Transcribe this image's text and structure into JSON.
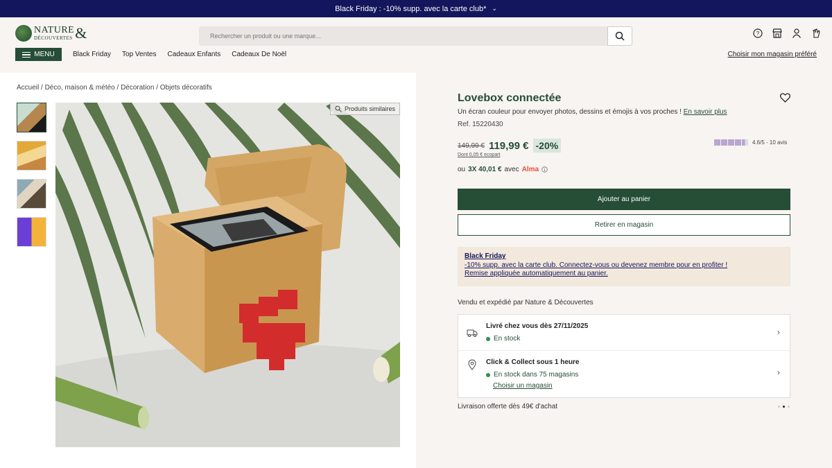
{
  "topbar": {
    "text": "Black Friday : -10% supp. avec la carte club*"
  },
  "header": {
    "logo_top": "NATURE",
    "logo_bottom": "DÉCOUVERTES",
    "logo_amp": "&",
    "search_placeholder": "Rechercher un produit ou une marque...",
    "menu_label": "MENU",
    "nav": [
      "Black Friday",
      "Top Ventes",
      "Cadeaux Enfants",
      "Cadeaux De Noël"
    ],
    "store_link": "Choisir mon magasin préféré"
  },
  "breadcrumb": "Accueil / Déco, maison & météo / Décoration / Objets décoratifs",
  "gallery": {
    "similar_label": "Produits similaires"
  },
  "product": {
    "title": "Lovebox connectée",
    "description": "Un écran couleur pour envoyer photos, dessins et émojis à vos proches !",
    "learn_more": "En savoir plus",
    "ref": "Ref. 15220430",
    "old_price": "149,99 €",
    "new_price": "119,99 €",
    "discount": "-20%",
    "eco_part": "Dont 0,05 € ecopart",
    "rating_value": 4.6,
    "rating_text": "4.6/5 - 10 avis",
    "alma_prefix": "ou",
    "alma_amount": "3X 40,01 €",
    "alma_mid": "avec",
    "alma_brand": "Alma",
    "add_to_cart": "Ajouter au panier",
    "pickup_store": "Retirer en magasin"
  },
  "promo": {
    "title": "Black Friday",
    "line1": "-10% supp. avec la carte club. Connectez-vous ou devenez membre pour en profiter !",
    "line2": "Remise appliquée automatiquement au panier."
  },
  "sold_by": "Vendu et expédié par Nature & Découvertes",
  "delivery": {
    "home_title": "Livré chez vous dès 27/11/2025",
    "home_stock": "En stock",
    "collect_title": "Click & Collect sous 1 heure",
    "collect_stock": "En stock dans 75 magasins",
    "collect_link": "Choisir un magasin"
  },
  "free_shipping": "Livraison offerte dès 49€ d'achat",
  "colors": {
    "brand_green": "#264d36",
    "topbar_navy": "#13165c",
    "promo_bg": "#f2e8dc",
    "alma_red": "#e94e3a"
  }
}
